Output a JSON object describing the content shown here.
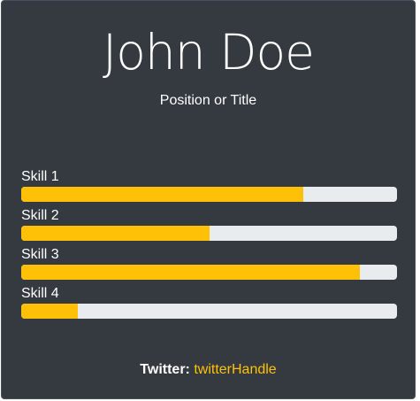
{
  "profile": {
    "name": "John Doe",
    "title": "Position or Title"
  },
  "skills": [
    {
      "label": "Skill 1",
      "level": 0.75
    },
    {
      "label": "Skill 2",
      "level": 0.5
    },
    {
      "label": "Skill 3",
      "level": 0.9
    },
    {
      "label": "Skill 4",
      "level": 0.15
    }
  ],
  "footer": {
    "twitter_label": "Twitter:",
    "twitter_handle": "twitterHandle"
  },
  "colors": {
    "background": "#343a40",
    "accent": "#ffc107",
    "track": "#e9ecef"
  }
}
